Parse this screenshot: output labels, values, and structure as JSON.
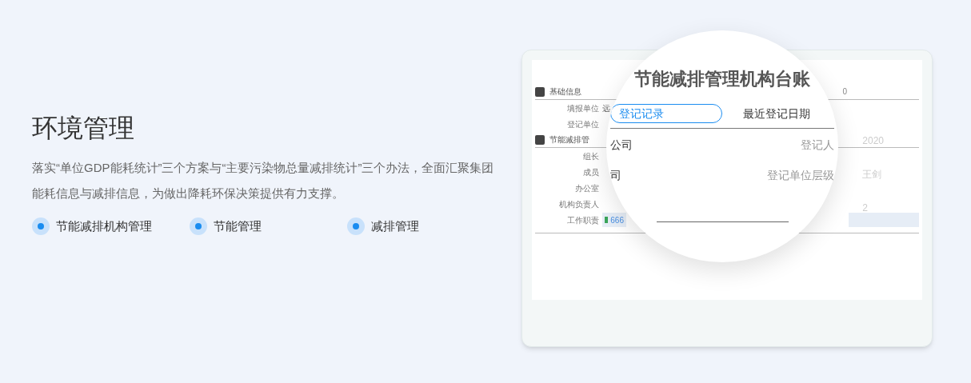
{
  "hero": {
    "title": "环境管理",
    "description": "落实“单位GDP能耗统计”三个方案与“主要污染物总量减排统计”三个办法，全面汇聚集团能耗信息与减排信息，为做出降耗环保决策提供有力支撑。",
    "features": [
      {
        "label": "节能减排机构管理"
      },
      {
        "label": "节能管理"
      },
      {
        "label": "减排管理"
      }
    ]
  },
  "screen": {
    "sections": [
      {
        "title": "基础信息",
        "fields": [
          {
            "label": "填报单位",
            "value": "远"
          },
          {
            "label": "登记单位"
          }
        ]
      },
      {
        "title": "节能减排管",
        "fields": [
          {
            "label": "组长"
          },
          {
            "label": "成员"
          },
          {
            "label": "办公室"
          },
          {
            "label": "机构负责人"
          },
          {
            "label": "工作职责",
            "value": "666"
          }
        ]
      }
    ],
    "right_values": [
      "0",
      "2020",
      "王剑",
      "2"
    ]
  },
  "magnifier": {
    "title": "节能减排管理机构台账",
    "tabs": [
      {
        "label": "登记记录",
        "selected": true
      },
      {
        "label": "最近登记日期",
        "selected": false
      }
    ],
    "rows": [
      {
        "value": "公司",
        "label": "登记人"
      },
      {
        "value": "司",
        "label": "登记单位层级"
      }
    ]
  }
}
